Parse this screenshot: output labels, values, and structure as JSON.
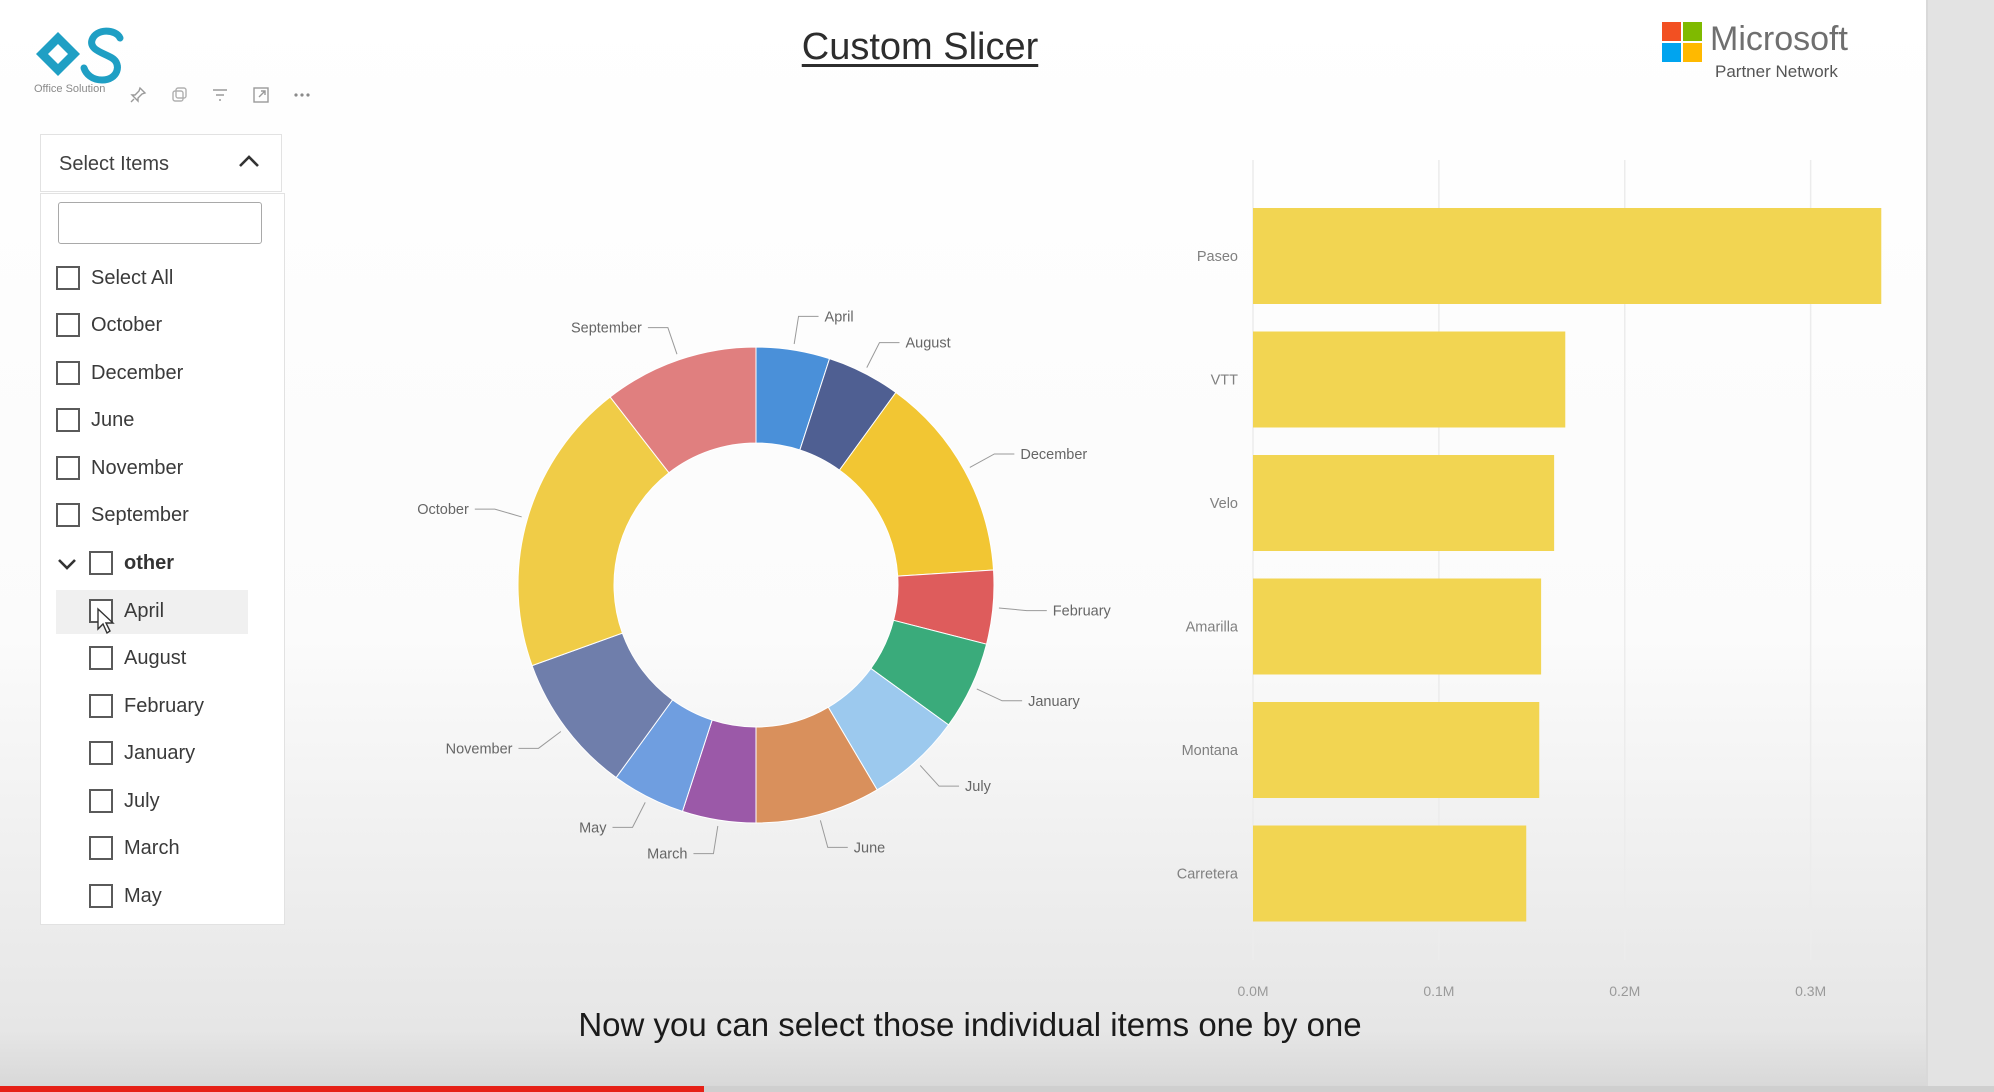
{
  "page": {
    "title": "Custom Slicer",
    "caption": "Now you can select those individual items one by one"
  },
  "branding": {
    "left_logo": {
      "icon": "office-solution-logo",
      "subtext": "Office Solution"
    },
    "right_logo": {
      "name": "Microsoft",
      "subtitle": "Partner Network",
      "colors": [
        "#f25022",
        "#7fba00",
        "#00a4ef",
        "#ffb900"
      ]
    }
  },
  "visual_header": {
    "icons": [
      "pin-icon",
      "copy-icon",
      "filter-icon",
      "focus-mode-icon",
      "more-options-icon"
    ]
  },
  "slicer": {
    "header_label": "Select Items",
    "search_value": "",
    "search_placeholder": "",
    "items": [
      {
        "label": "Select All",
        "checked": false
      },
      {
        "label": "October",
        "checked": false
      },
      {
        "label": "December",
        "checked": false
      },
      {
        "label": "June",
        "checked": false
      },
      {
        "label": "November",
        "checked": false
      },
      {
        "label": "September",
        "checked": false
      }
    ],
    "group": {
      "label": "other",
      "expanded": true,
      "children": [
        {
          "label": "April",
          "checked": false,
          "hovered": true
        },
        {
          "label": "August",
          "checked": false
        },
        {
          "label": "February",
          "checked": false
        },
        {
          "label": "January",
          "checked": false
        },
        {
          "label": "July",
          "checked": false
        },
        {
          "label": "March",
          "checked": false
        },
        {
          "label": "May",
          "checked": false
        }
      ]
    }
  },
  "chart_data": [
    {
      "type": "pie",
      "subtype": "donut",
      "slices": [
        {
          "label": "April",
          "value": 5.0,
          "color": "#4a90d9"
        },
        {
          "label": "August",
          "value": 5.0,
          "color": "#4f5f92"
        },
        {
          "label": "December",
          "value": 14.0,
          "color": "#f2c633"
        },
        {
          "label": "February",
          "value": 5.0,
          "color": "#de5c5c"
        },
        {
          "label": "January",
          "value": 6.0,
          "color": "#3aab7b"
        },
        {
          "label": "July",
          "value": 6.5,
          "color": "#9cc9ee"
        },
        {
          "label": "June",
          "value": 8.5,
          "color": "#d9905c"
        },
        {
          "label": "March",
          "value": 5.0,
          "color": "#9b59a8"
        },
        {
          "label": "May",
          "value": 5.0,
          "color": "#6f9ee0"
        },
        {
          "label": "November",
          "value": 9.5,
          "color": "#6f7eab"
        },
        {
          "label": "October",
          "value": 20.0,
          "color": "#f0cc47"
        },
        {
          "label": "September",
          "value": 10.5,
          "color": "#e07f7f"
        }
      ]
    },
    {
      "type": "bar",
      "orientation": "horizontal",
      "color": "#f2d552",
      "categories": [
        "Paseo",
        "VTT",
        "Velo",
        "Amarilla",
        "Montana",
        "Carretera"
      ],
      "values": [
        0.338,
        0.168,
        0.162,
        0.155,
        0.154,
        0.147
      ],
      "xlim": [
        0,
        0.34
      ],
      "x_ticks": [
        "0.0M",
        "0.1M",
        "0.2M",
        "0.3M"
      ],
      "grid": true
    }
  ],
  "video": {
    "progress": 0.353
  }
}
